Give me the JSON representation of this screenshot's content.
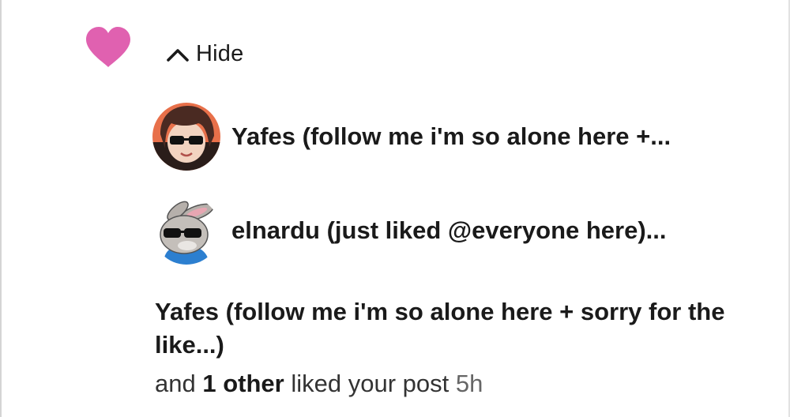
{
  "notification": {
    "accent_color": "#e061b0",
    "icon": "heart-icon",
    "toggle": {
      "icon": "chevron-up-icon",
      "label": "Hide"
    },
    "likers": [
      {
        "name": "Yafes (follow me i'm so alone here +...",
        "avatar": "user-avatar"
      },
      {
        "name": "elnardu (just liked @everyone here)...",
        "avatar": "rabbit-avatar"
      }
    ],
    "summary_name": "Yafes (follow me i'm so alone here + sorry for the like...)",
    "sub": {
      "prefix": "and",
      "count": "1",
      "others_word": "other",
      "action": "liked your post",
      "time": "5h"
    }
  }
}
